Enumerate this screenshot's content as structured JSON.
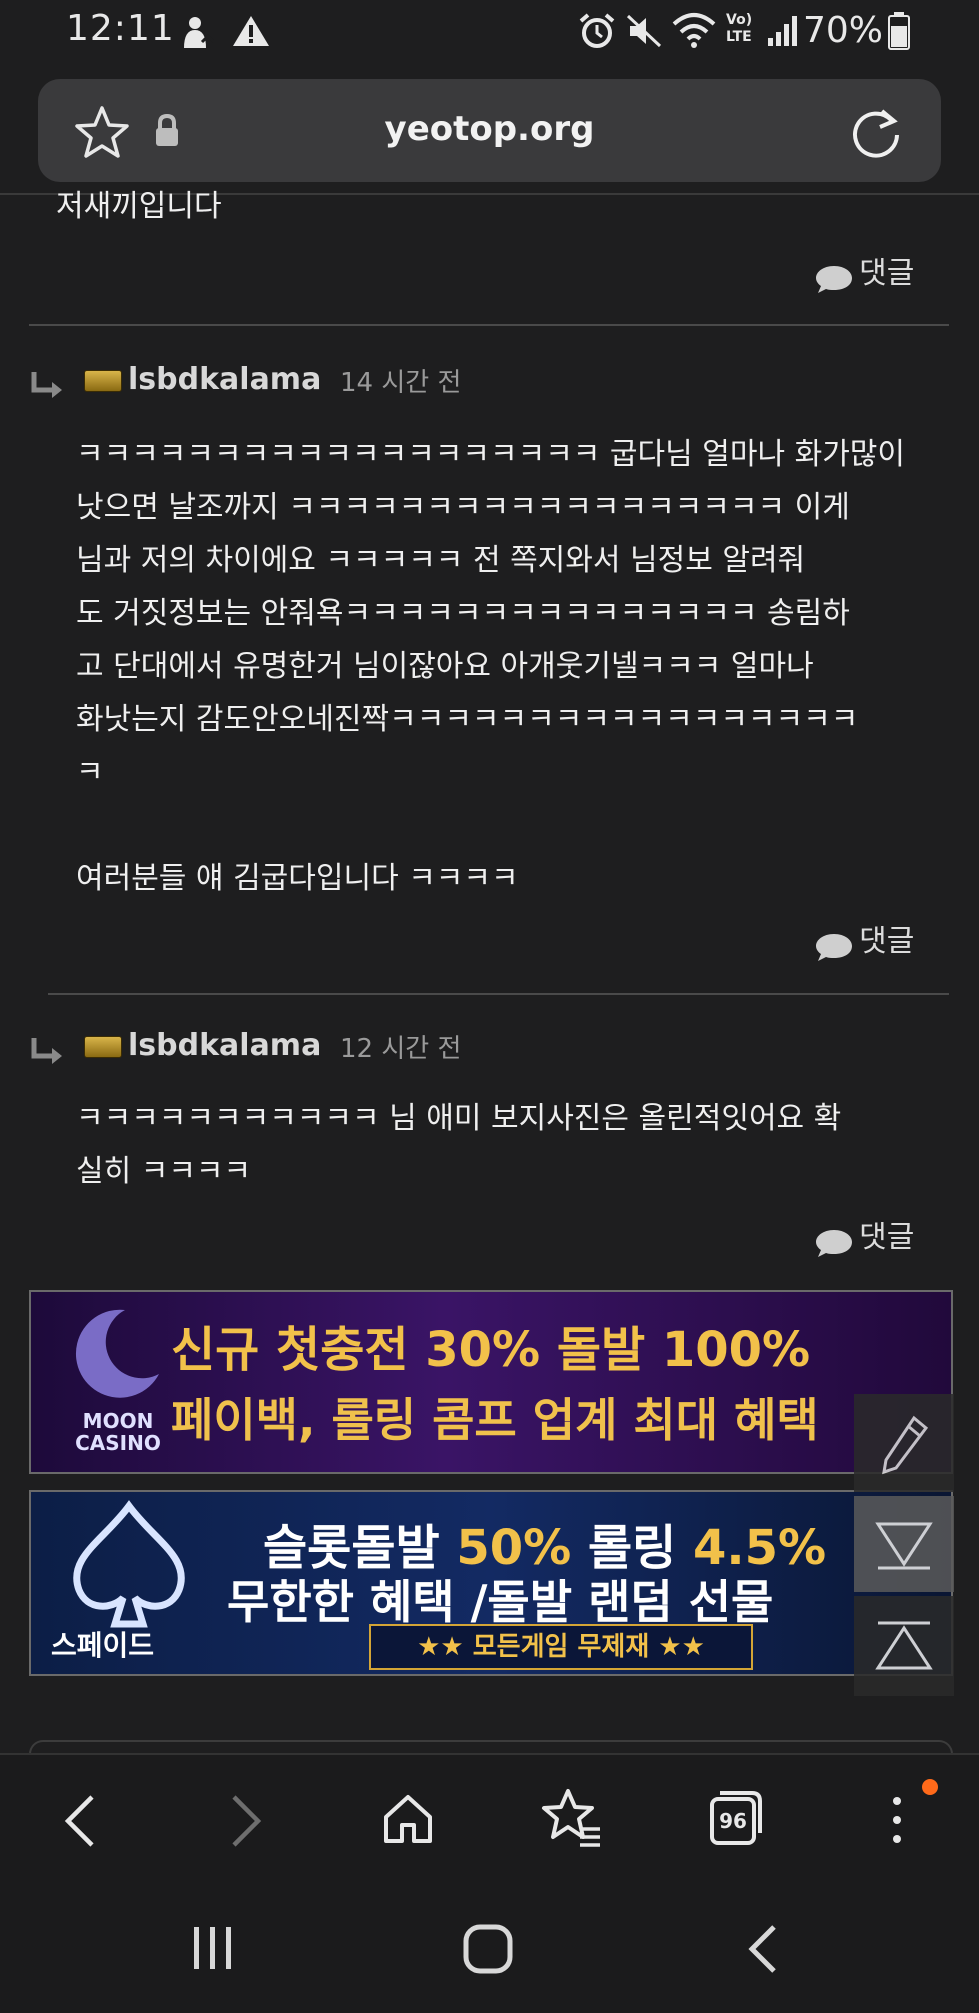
{
  "status_bar": {
    "time": "12:11",
    "battery": "70%",
    "icons": [
      "upload-person-icon",
      "alert-icon",
      "alarm-icon",
      "mute-icon",
      "wifi-icon",
      "volte-icon",
      "signal-icon",
      "battery-icon"
    ],
    "volte_label": "Vo) LTE"
  },
  "browser": {
    "url": "yeotop.org",
    "icons": [
      "star-icon",
      "lock-icon",
      "reload-icon"
    ]
  },
  "comments": [
    {
      "text_tail": "저새끼입니다",
      "reply_label": "댓글"
    },
    {
      "author": "lsbdkalama",
      "time": "14 시간 전",
      "lines": [
        "ㅋㅋㅋㅋㅋㅋㅋㅋㅋㅋㅋㅋㅋㅋㅋㅋㅋㅋㅋ 굽다님 얼마나 화가많이",
        "낫으면 날조까지 ㅋㅋㅋㅋㅋㅋㅋㅋㅋㅋㅋㅋㅋㅋㅋㅋㅋㅋ 이게",
        "님과 저의 차이에요 ㅋㅋㅋㅋㅋ 전 쪽지와서 님정보 알려줘",
        "도 거짓정보는 안줘욕ㅋㅋㅋㅋㅋㅋㅋㅋㅋㅋㅋㅋㅋㅋㅋ 송림하",
        "고 단대에서 유명한거 님이잖아요 아개웃기넬ㅋㅋㅋ 얼마나",
        "화낫는지 감도안오네진짝ㅋㅋㅋㅋㅋㅋㅋㅋㅋㅋㅋㅋㅋㅋㅋㅋㅋ",
        "ㅋ"
      ],
      "extra_line": "여러분들 얘 김굽다입니다 ㅋㅋㅋㅋ",
      "reply_label": "댓글"
    },
    {
      "author": "lsbdkalama",
      "time": "12 시간 전",
      "lines": [
        "ㅋㅋㅋㅋㅋㅋㅋㅋㅋㅋㅋ 님 애미 보지사진은 올린적잇어요 확",
        "실히 ㅋㅋㅋㅋ"
      ],
      "reply_label": "댓글"
    }
  ],
  "banners": [
    {
      "logo_line1": "MOON",
      "logo_line2": "CASINO",
      "line1": "신규 첫충전 30% 돌발 100%",
      "line2": "페이백, 롤링 콤프 업계 최대 혜택"
    },
    {
      "logo_label": "스페이드",
      "line1_a": "슬롯돌발 ",
      "line1_b": "50%",
      "line1_c": " 롤링 ",
      "line1_d": "4.5%",
      "line2": "무한한 혜택 /돌발 랜덤 선물",
      "tag_a": "★★ 모든게임 ",
      "tag_b": "무제재",
      "tag_c": " ★★"
    }
  ],
  "side_buttons": [
    "pencil-icon",
    "scroll-down-icon",
    "scroll-up-icon"
  ],
  "bottom_nav": {
    "tabs_count": "96",
    "items": [
      "back",
      "forward",
      "home",
      "bookmarks",
      "tabs",
      "menu"
    ]
  },
  "colors": {
    "background": "#1e1e1f",
    "text": "#efefef",
    "muted": "#9a9a9a",
    "accent_orange": "#ff6a1a",
    "banner_gold": "#f2c14a"
  }
}
